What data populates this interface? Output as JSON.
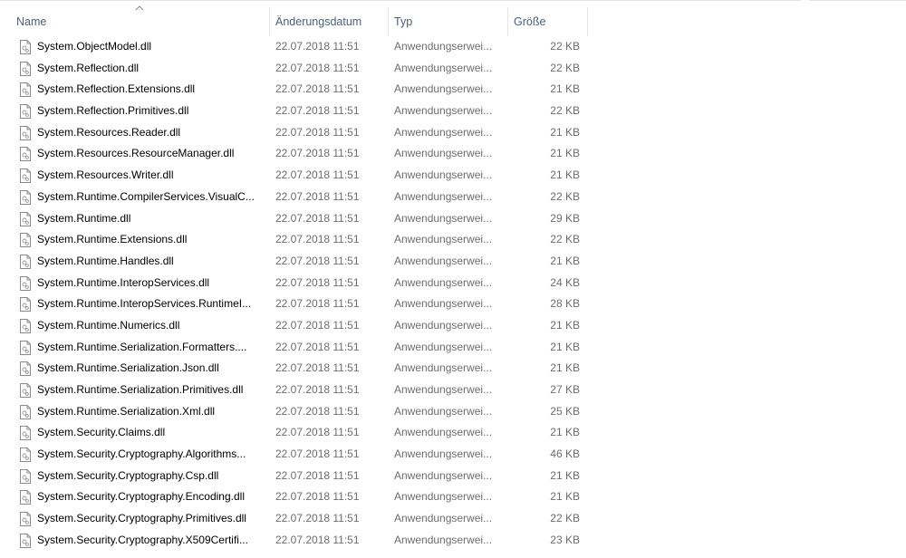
{
  "columns": {
    "name": "Name",
    "date": "Änderungsdatum",
    "type": "Typ",
    "size": "Größe"
  },
  "sort": {
    "column": "name",
    "direction": "ascending",
    "icon": "chevron-up-icon"
  },
  "file_icon": "dll-file-icon",
  "files": [
    {
      "name": "System.ObjectModel.dll",
      "date": "22.07.2018 11:51",
      "type": "Anwendungserwei...",
      "size": "22 KB"
    },
    {
      "name": "System.Reflection.dll",
      "date": "22.07.2018 11:51",
      "type": "Anwendungserwei...",
      "size": "22 KB"
    },
    {
      "name": "System.Reflection.Extensions.dll",
      "date": "22.07.2018 11:51",
      "type": "Anwendungserwei...",
      "size": "21 KB"
    },
    {
      "name": "System.Reflection.Primitives.dll",
      "date": "22.07.2018 11:51",
      "type": "Anwendungserwei...",
      "size": "22 KB"
    },
    {
      "name": "System.Resources.Reader.dll",
      "date": "22.07.2018 11:51",
      "type": "Anwendungserwei...",
      "size": "21 KB"
    },
    {
      "name": "System.Resources.ResourceManager.dll",
      "date": "22.07.2018 11:51",
      "type": "Anwendungserwei...",
      "size": "21 KB"
    },
    {
      "name": "System.Resources.Writer.dll",
      "date": "22.07.2018 11:51",
      "type": "Anwendungserwei...",
      "size": "21 KB"
    },
    {
      "name": "System.Runtime.CompilerServices.VisualC...",
      "date": "22.07.2018 11:51",
      "type": "Anwendungserwei...",
      "size": "22 KB"
    },
    {
      "name": "System.Runtime.dll",
      "date": "22.07.2018 11:51",
      "type": "Anwendungserwei...",
      "size": "29 KB"
    },
    {
      "name": "System.Runtime.Extensions.dll",
      "date": "22.07.2018 11:51",
      "type": "Anwendungserwei...",
      "size": "22 KB"
    },
    {
      "name": "System.Runtime.Handles.dll",
      "date": "22.07.2018 11:51",
      "type": "Anwendungserwei...",
      "size": "21 KB"
    },
    {
      "name": "System.Runtime.InteropServices.dll",
      "date": "22.07.2018 11:51",
      "type": "Anwendungserwei...",
      "size": "24 KB"
    },
    {
      "name": "System.Runtime.InteropServices.RuntimeI...",
      "date": "22.07.2018 11:51",
      "type": "Anwendungserwei...",
      "size": "28 KB"
    },
    {
      "name": "System.Runtime.Numerics.dll",
      "date": "22.07.2018 11:51",
      "type": "Anwendungserwei...",
      "size": "21 KB"
    },
    {
      "name": "System.Runtime.Serialization.Formatters....",
      "date": "22.07.2018 11:51",
      "type": "Anwendungserwei...",
      "size": "21 KB"
    },
    {
      "name": "System.Runtime.Serialization.Json.dll",
      "date": "22.07.2018 11:51",
      "type": "Anwendungserwei...",
      "size": "21 KB"
    },
    {
      "name": "System.Runtime.Serialization.Primitives.dll",
      "date": "22.07.2018 11:51",
      "type": "Anwendungserwei...",
      "size": "27 KB"
    },
    {
      "name": "System.Runtime.Serialization.Xml.dll",
      "date": "22.07.2018 11:51",
      "type": "Anwendungserwei...",
      "size": "25 KB"
    },
    {
      "name": "System.Security.Claims.dll",
      "date": "22.07.2018 11:51",
      "type": "Anwendungserwei...",
      "size": "21 KB"
    },
    {
      "name": "System.Security.Cryptography.Algorithms...",
      "date": "22.07.2018 11:51",
      "type": "Anwendungserwei...",
      "size": "46 KB"
    },
    {
      "name": "System.Security.Cryptography.Csp.dll",
      "date": "22.07.2018 11:51",
      "type": "Anwendungserwei...",
      "size": "21 KB"
    },
    {
      "name": "System.Security.Cryptography.Encoding.dll",
      "date": "22.07.2018 11:51",
      "type": "Anwendungserwei...",
      "size": "21 KB"
    },
    {
      "name": "System.Security.Cryptography.Primitives.dll",
      "date": "22.07.2018 11:51",
      "type": "Anwendungserwei...",
      "size": "22 KB"
    },
    {
      "name": "System.Security.Cryptography.X509Certifi...",
      "date": "22.07.2018 11:51",
      "type": "Anwendungserwei...",
      "size": "23 KB"
    }
  ]
}
